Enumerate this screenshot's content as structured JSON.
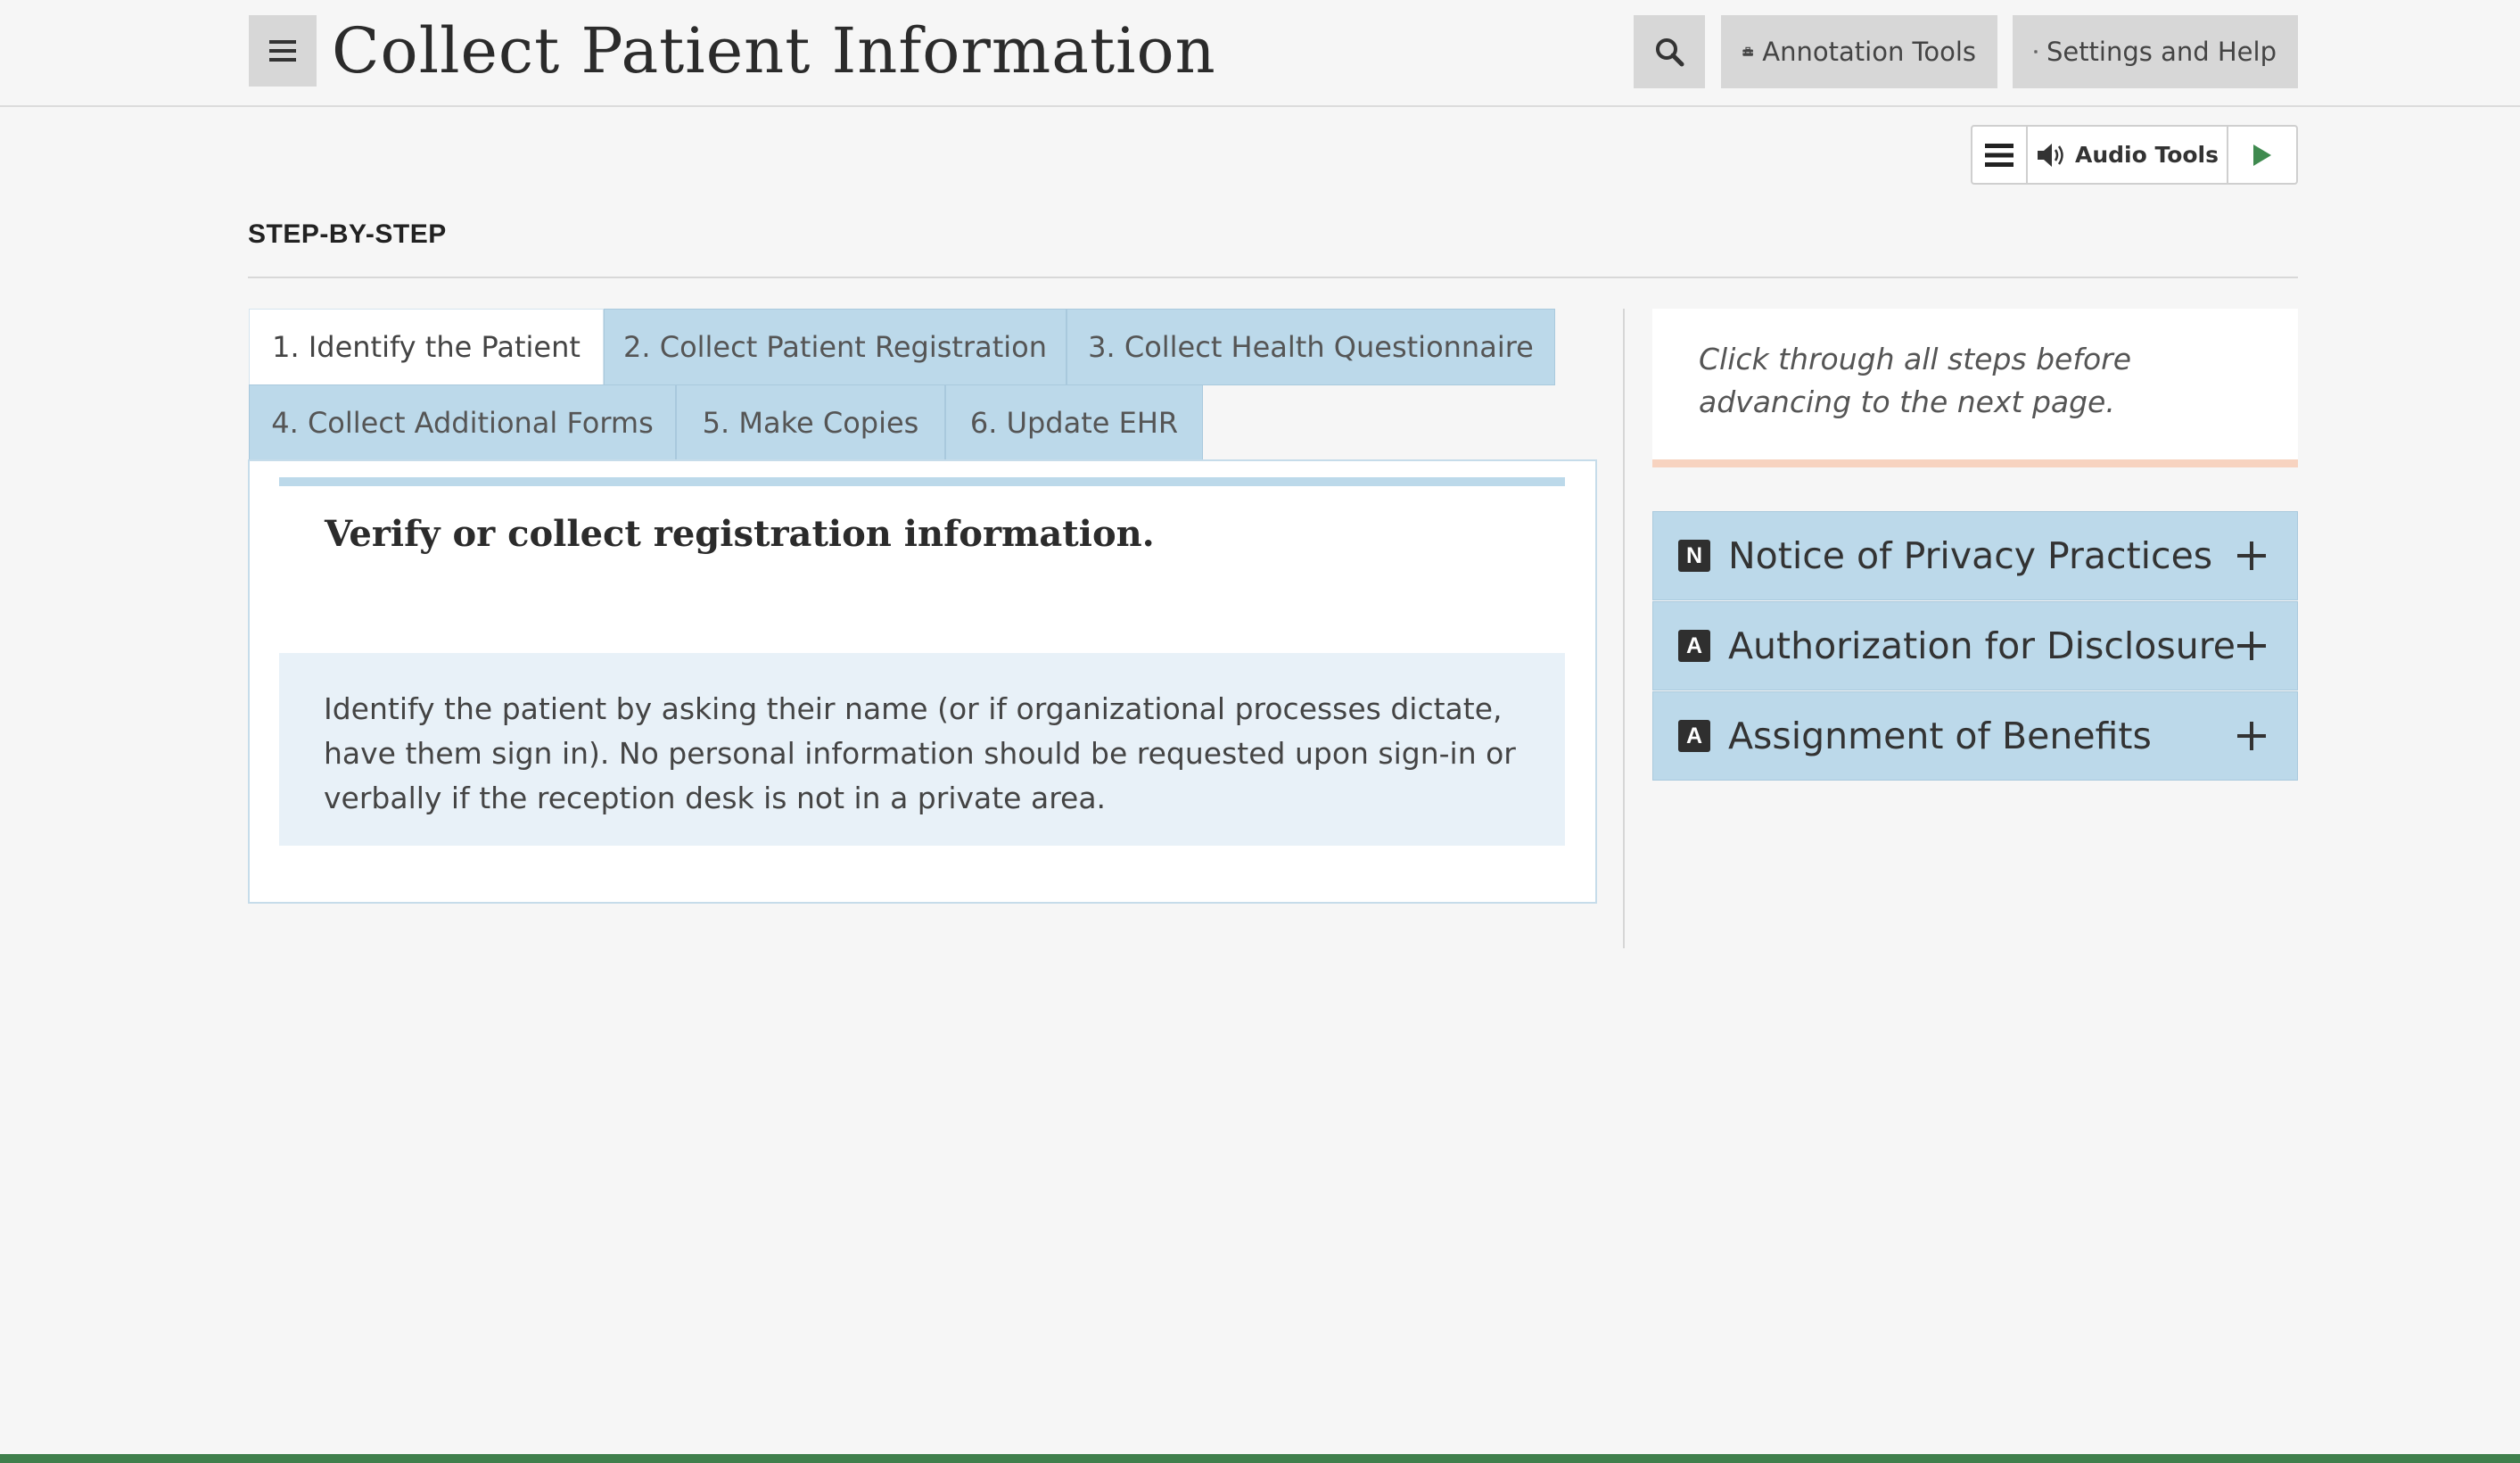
{
  "header": {
    "title": "Collect Patient Information",
    "annotation_tools_label": "Annotation Tools",
    "settings_help_label": "Settings and Help"
  },
  "audio": {
    "label": "Audio Tools"
  },
  "section": {
    "heading": "STEP-BY-STEP"
  },
  "tabs": [
    {
      "label": "1. Identify the Patient",
      "active": true
    },
    {
      "label": "2. Collect Patient Registration",
      "active": false
    },
    {
      "label": "3. Collect Health Questionnaire",
      "active": false
    },
    {
      "label": "4. Collect Additional Forms",
      "active": false
    },
    {
      "label": "5. Make Copies",
      "active": false
    },
    {
      "label": "6. Update EHR",
      "active": false
    }
  ],
  "panel": {
    "heading": "Verify or collect registration information.",
    "body": "Identify the patient by asking their name (or if organizational processes dictate, have them sign in). No personal information should be requested upon sign-in or verbally if the reception desk is not in a private area."
  },
  "note": {
    "text": "Click through all steps before advancing to the next page."
  },
  "accordion": [
    {
      "badge": "N",
      "label": "Notice of Privacy Practices"
    },
    {
      "badge": "A",
      "label": "Authorization for Disclosure"
    },
    {
      "badge": "A",
      "label": "Assignment of Benefits"
    }
  ],
  "colors": {
    "tab_blue": "#bcd9ea",
    "info_bg": "#e8f1f8",
    "note_accent": "#f7d3c0",
    "bottom_bar": "#3f7f4c"
  },
  "icons": {
    "menu": "hamburger-icon",
    "search": "search-icon",
    "annotation": "toolbox-icon",
    "settings": "gear-icon",
    "audio_list": "list-icon",
    "audio": "speaker-icon",
    "play": "play-icon",
    "expand": "plus-icon"
  }
}
